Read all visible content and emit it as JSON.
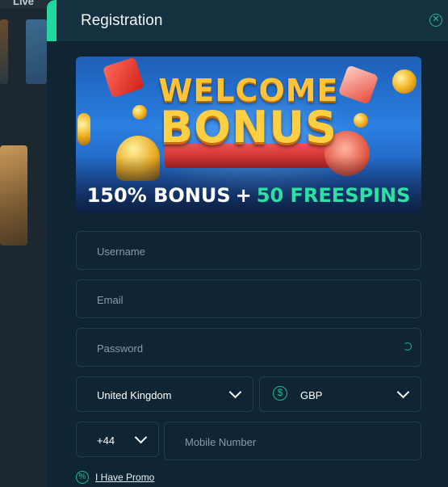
{
  "background": {
    "nav_label": "Live"
  },
  "modal": {
    "title": "Registration",
    "close_icon": "close-icon",
    "accent_color": "#22d7a0"
  },
  "banner": {
    "headline_top": "WELCOME",
    "headline_bottom": "BONUS",
    "bonus_text": "150% BONUS",
    "plus": "+",
    "freespins_text": "50 FREESPINS"
  },
  "form": {
    "username": {
      "placeholder": "Username",
      "value": ""
    },
    "email": {
      "placeholder": "Email",
      "value": ""
    },
    "password": {
      "placeholder": "Password",
      "value": "",
      "toggle_icon": "eye-icon"
    },
    "country": {
      "selected": "United Kingdom"
    },
    "currency": {
      "selected": "GBP",
      "icon": "dollar-icon"
    },
    "phone_code": {
      "selected": "+44"
    },
    "mobile": {
      "placeholder": "Mobile Number",
      "value": ""
    },
    "promo_link": "I Have Promo"
  }
}
